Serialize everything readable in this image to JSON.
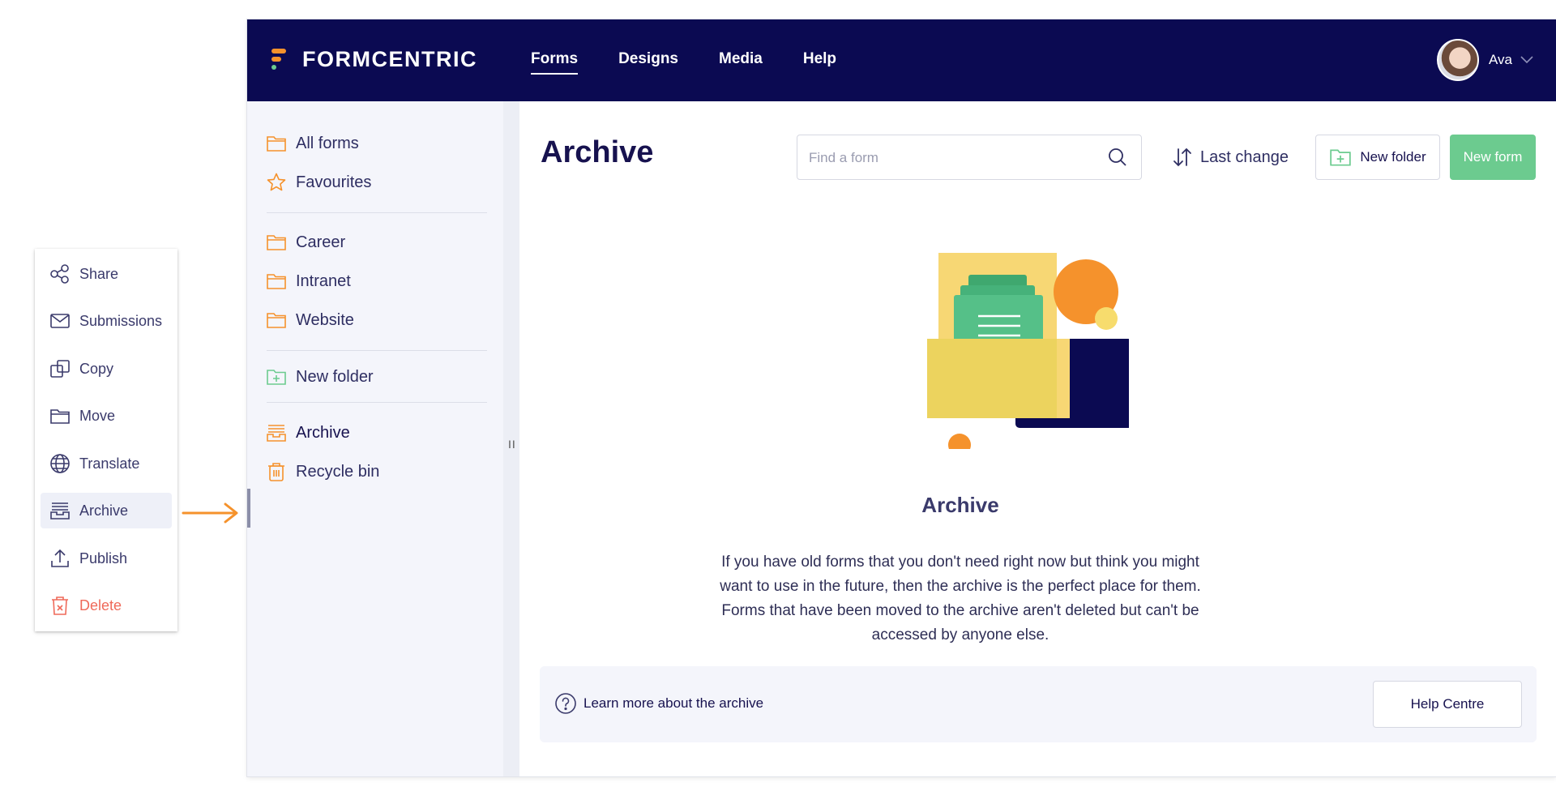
{
  "context_menu": {
    "items": [
      {
        "label": "Share",
        "icon": "share-icon"
      },
      {
        "label": "Submissions",
        "icon": "envelope-icon"
      },
      {
        "label": "Copy",
        "icon": "copy-icon"
      },
      {
        "label": "Move",
        "icon": "folder-icon"
      },
      {
        "label": "Translate",
        "icon": "globe-icon"
      },
      {
        "label": "Archive",
        "icon": "archive-icon"
      },
      {
        "label": "Publish",
        "icon": "upload-icon"
      },
      {
        "label": "Delete",
        "icon": "trash-icon"
      }
    ]
  },
  "header": {
    "brand": "FORMCENTRIC",
    "nav": [
      "Forms",
      "Designs",
      "Media",
      "Help"
    ],
    "active_nav": "Forms",
    "user_name": "Ava"
  },
  "sidebar": {
    "top_items": [
      {
        "label": "All forms",
        "icon": "folder-icon"
      },
      {
        "label": "Favourites",
        "icon": "star-icon"
      }
    ],
    "folders": [
      {
        "label": "Career",
        "icon": "folder-icon"
      },
      {
        "label": "Intranet",
        "icon": "folder-icon"
      },
      {
        "label": "Website",
        "icon": "folder-icon"
      }
    ],
    "new_folder": "New folder",
    "bottom_items": [
      {
        "label": "Archive",
        "icon": "archive-icon"
      },
      {
        "label": "Recycle bin",
        "icon": "trash-icon"
      }
    ],
    "collapse_handle": "II"
  },
  "main": {
    "title": "Archive",
    "search_placeholder": "Find a form",
    "sort_label": "Last change",
    "new_folder_label": "New folder",
    "new_form_label": "New form",
    "empty_title": "Archive",
    "empty_text": "If you have old forms that you don't need right now but think you might want to use in the future, then the archive is the perfect place for them. Forms that have been moved to the archive aren't deleted but can't be accessed by anyone else.",
    "help_link": "Learn more about the archive",
    "help_button": "Help Centre"
  },
  "colors": {
    "header_bg": "#0b0a52",
    "accent_orange": "#f5922c",
    "accent_green": "#6ccb8f",
    "delete_red": "#ef6a5a",
    "sidebar_bg": "#f4f5fb"
  }
}
